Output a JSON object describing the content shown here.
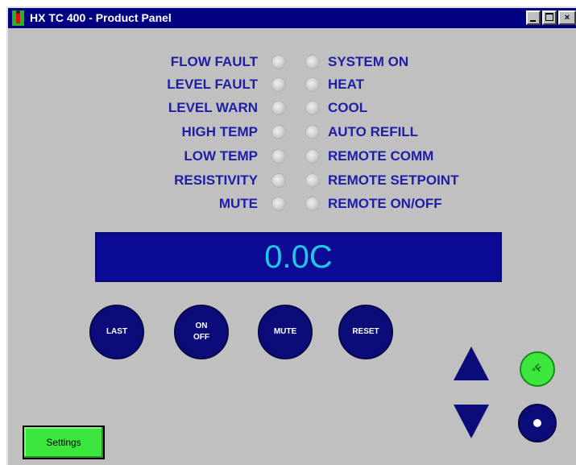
{
  "window": {
    "title": "HX TC 400 - Product Panel",
    "controls": {
      "minimize": "",
      "maximize": "",
      "close": "×"
    }
  },
  "indicators": {
    "left": [
      {
        "label": "FLOW FAULT"
      },
      {
        "label": "LEVEL FAULT"
      },
      {
        "label": "LEVEL WARN"
      },
      {
        "label": "HIGH TEMP"
      },
      {
        "label": "LOW TEMP"
      },
      {
        "label": "RESISTIVITY"
      },
      {
        "label": "MUTE"
      }
    ],
    "right": [
      {
        "label": "SYSTEM ON"
      },
      {
        "label": "HEAT"
      },
      {
        "label": "COOL"
      },
      {
        "label": "AUTO REFILL"
      },
      {
        "label": "REMOTE COMM"
      },
      {
        "label": "REMOTE SETPOINT"
      },
      {
        "label": "REMOTE ON/OFF"
      }
    ]
  },
  "display": {
    "reading": "0.0C"
  },
  "buttons": {
    "last": "LAST",
    "on_off": "ON\nOFF",
    "mute": "MUTE",
    "reset": "RESET",
    "unit_toggle": "°F",
    "settings": "Settings"
  },
  "colors": {
    "label_blue": "#1e1ea8",
    "button_navy": "#0b0b7a",
    "display_bg": "#0b0b96",
    "display_text": "#21c7e6",
    "accent_green": "#3de63d",
    "panel_gray": "#c0c0c0",
    "title_bar": "#000080"
  },
  "icons": {
    "app": "thermometer-person-icon",
    "up": "arrow-up-icon",
    "down": "arrow-down-icon",
    "enter": "enter-dot-icon"
  }
}
